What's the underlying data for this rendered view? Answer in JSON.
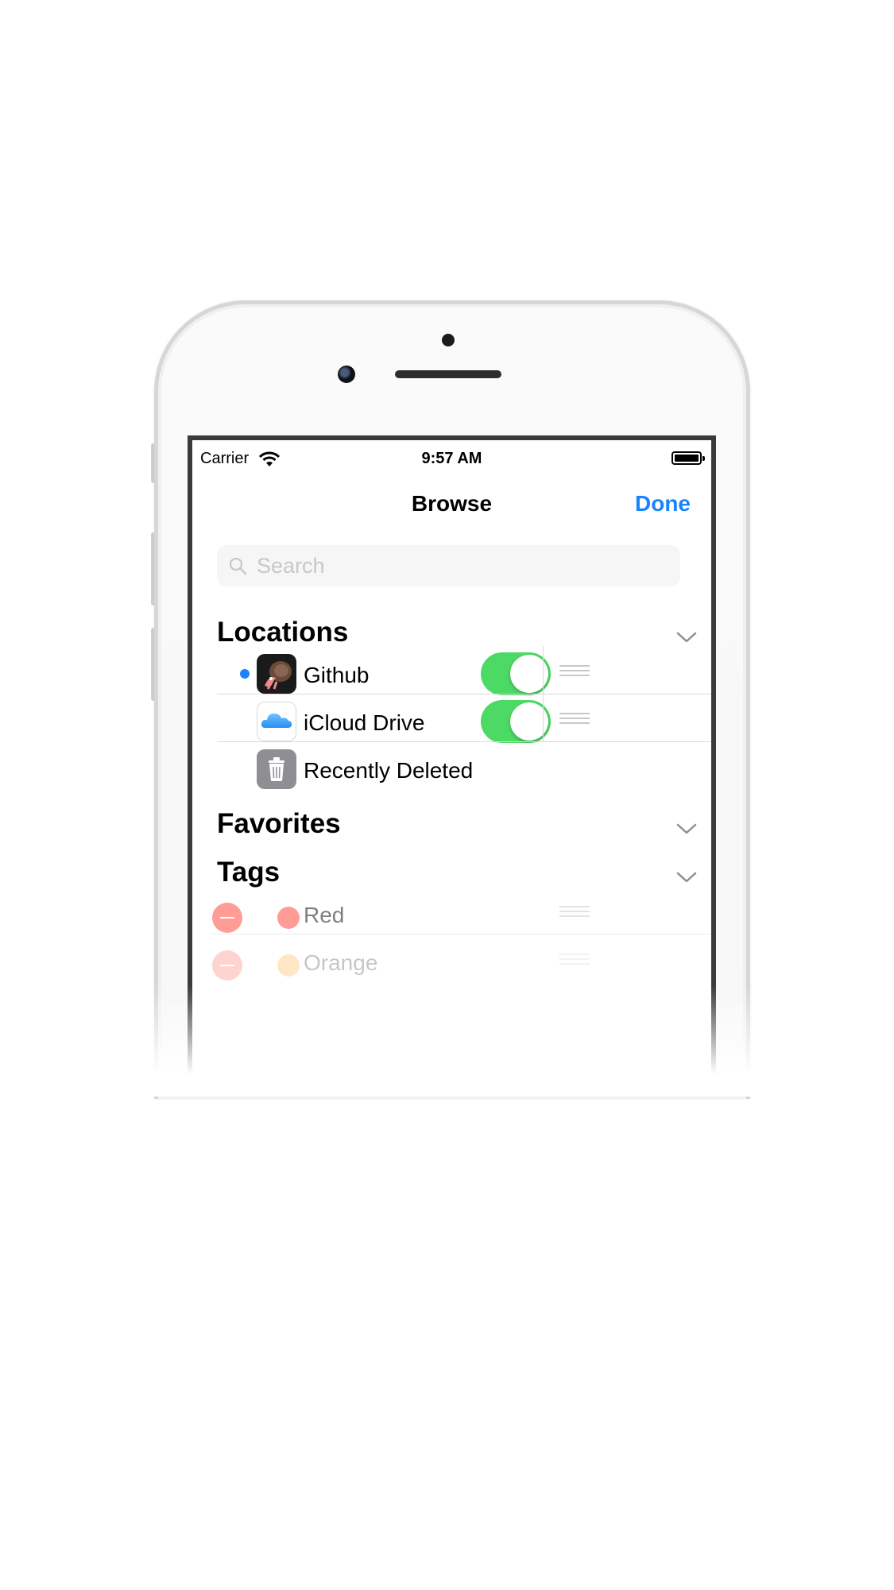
{
  "status_bar": {
    "carrier": "Carrier",
    "time": "9:57 AM"
  },
  "nav": {
    "title": "Browse",
    "done_label": "Done"
  },
  "search": {
    "placeholder": "Search"
  },
  "sections": {
    "locations": "Locations",
    "favorites": "Favorites",
    "tags": "Tags"
  },
  "locations": [
    {
      "label": "Github",
      "enabled": true,
      "current": true
    },
    {
      "label": "iCloud Drive",
      "enabled": true,
      "current": false
    },
    {
      "label": "Recently Deleted"
    }
  ],
  "tags": [
    {
      "label": "Red",
      "color": "#ff3b30"
    },
    {
      "label": "Orange",
      "color": "#ff9500"
    }
  ],
  "colors": {
    "accent": "#1a82fb",
    "toggle_on": "#4cd964"
  },
  "icons": {
    "github_app": "octocat-hermit-crab-icon",
    "icloud": "cloud-icon",
    "trash": "trash-icon",
    "search": "search-icon",
    "chevron": "chevron-down-icon",
    "reorder": "reorder-grip-icon"
  }
}
